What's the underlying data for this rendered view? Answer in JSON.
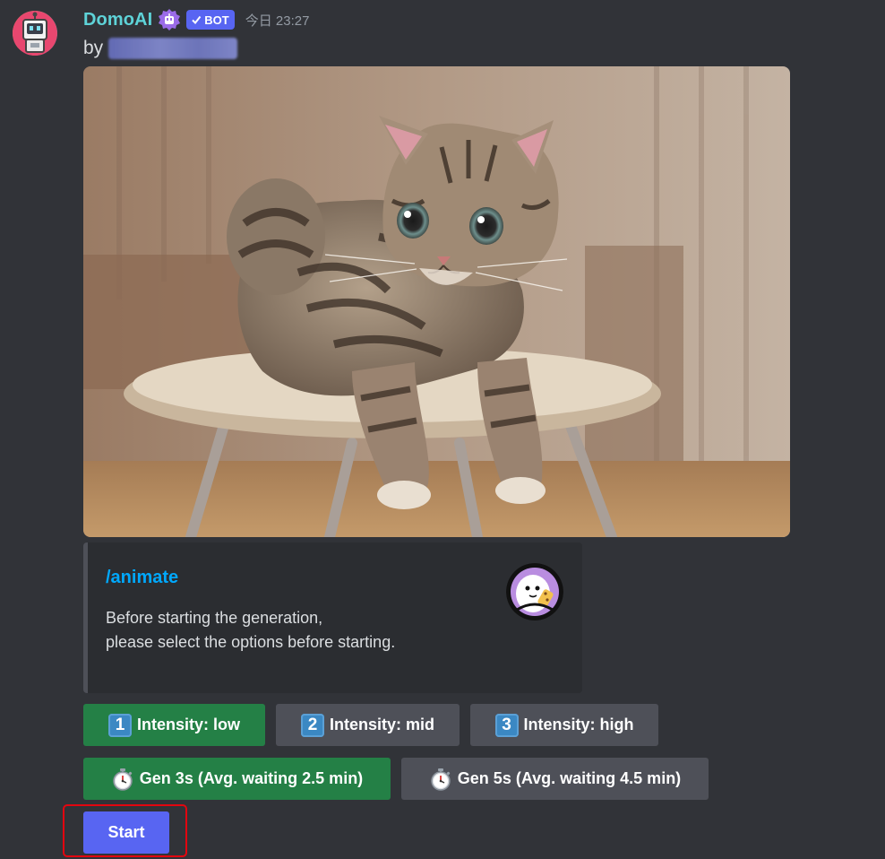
{
  "message": {
    "author": "DomoAI",
    "bot_badge": "BOT",
    "timestamp": "今日 23:27",
    "byline_prefix": "by",
    "role_icon": "robot-role-icon",
    "avatar_icon": "robot-avatar"
  },
  "attachment": {
    "subject": "tabby-kitten-on-stool"
  },
  "embed": {
    "title": "/animate",
    "description_line1": "Before starting the generation,",
    "description_line2": "please select the options before starting.",
    "thumbnail_icon": "domo-mascot-icon"
  },
  "buttons": {
    "intensity_low": {
      "emoji": "1",
      "label": "Intensity: low"
    },
    "intensity_mid": {
      "emoji": "2",
      "label": "Intensity: mid"
    },
    "intensity_high": {
      "emoji": "3",
      "label": "Intensity: high"
    },
    "gen_3s": {
      "emoji": "stopwatch-icon",
      "label": "Gen 3s (Avg. waiting 2.5 min)"
    },
    "gen_5s": {
      "emoji": "stopwatch-icon",
      "label": "Gen 5s (Avg. waiting 4.5 min)"
    },
    "start": {
      "label": "Start"
    }
  },
  "colors": {
    "background": "#313338",
    "username": "#5ed3d8",
    "bot_badge": "#5865f2",
    "embed_title": "#00a8fc",
    "button_success": "#248046",
    "button_secondary": "#4e5058",
    "button_primary": "#5865f2",
    "highlight_box": "#e3060f"
  }
}
